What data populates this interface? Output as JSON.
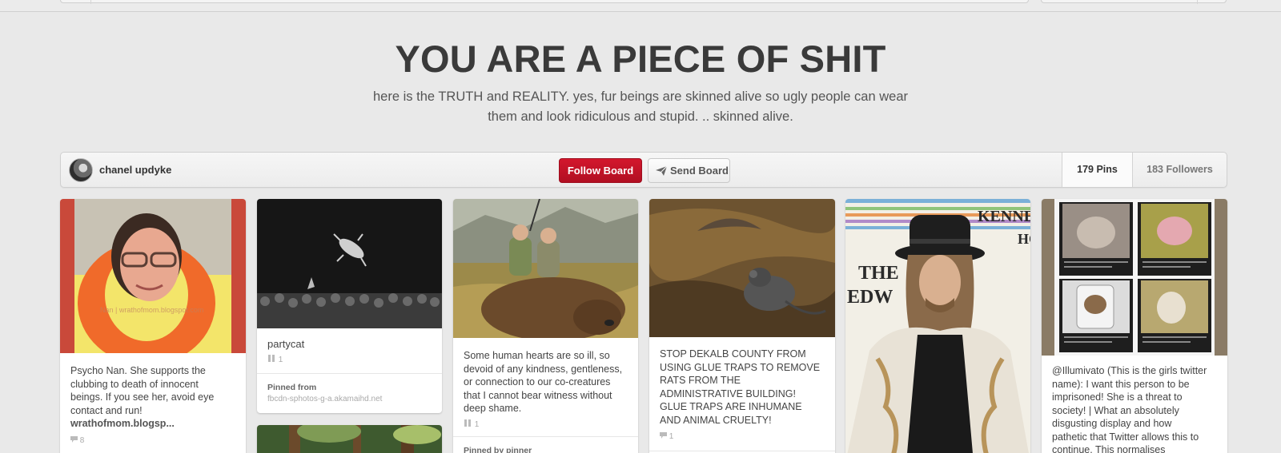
{
  "board": {
    "title": "YOU ARE A PIECE OF SHIT",
    "description_line1": "here is the TRUTH and REALITY. yes, fur beings are skinned alive so ugly people can wear",
    "description_line2": "them and look ridiculous and stupid. .. skinned alive."
  },
  "boardbar": {
    "owner_name": "chanel updyke",
    "follow_label": "Follow Board",
    "send_label": "Send Board",
    "pins_count": "179 Pins",
    "followers_count": "183 Followers"
  },
  "pins": [
    {
      "desc_lines": [
        "Psycho Nan. She supports the",
        "clubbing to death of innocent",
        "beings. If you see her, avoid eye",
        "contact and run!"
      ],
      "link": "wrathofmom.blogsp...",
      "count": "8",
      "count_icon": "comment-icon"
    },
    {
      "desc_lines": [
        "partycat"
      ],
      "count": "1",
      "count_icon": "repin-icon",
      "from_heading": "Pinned from",
      "from_source": "fbcdn-sphotos-g-a.akamaihd.net"
    },
    {
      "desc_lines": [
        "Some human hearts are so ill, so",
        "devoid of any kindness, gentleness,",
        "or connection to our co-creatures",
        "that I cannot bear witness without",
        "deep shame."
      ],
      "count": "1",
      "count_icon": "repin-icon",
      "from_heading": "Pinned by pinner"
    },
    {
      "desc_lines": [
        "STOP DEKALB COUNTY FROM",
        "USING GLUE TRAPS TO REMOVE",
        "RATS FROM THE",
        "ADMINISTRATIVE BUILDING!",
        "GLUE TRAPS ARE INHUMANE",
        "AND ANIMAL CRUELTY!"
      ],
      "count": "1",
      "count_icon": "comment-icon"
    },
    {
      "desc_lines": []
    },
    {
      "desc_lines": [
        "@Illumivato (This is the girls twitter",
        "name): I want this person to be",
        "imprisoned! She is a threat to",
        "society! | What an absolutely",
        "disgusting display and how",
        "pathetic that Twitter allows this to",
        "continue. This normalises"
      ]
    }
  ],
  "image_text": {
    "pin5_sign_top": "KENNE",
    "pin5_sign_mid": "THE",
    "pin5_sign_mid2": "EDW",
    "pin5_sign_ho": "HO",
    "pin1_watermark": "Nan | wrathofmom.blogspot.com"
  },
  "colors": {
    "accent": "#c8102e",
    "page_bg": "#e9e9e9"
  }
}
